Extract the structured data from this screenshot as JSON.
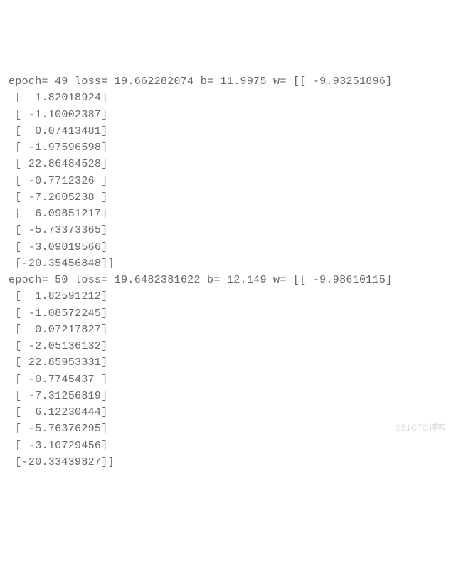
{
  "blocks": [
    {
      "epoch": 49,
      "loss": "19.662282074",
      "b": "11.9975",
      "w": [
        " -9.93251896",
        "  1.82018924",
        " -1.10002387",
        "  0.07413481",
        " -1.97596598",
        " 22.86484528",
        " -0.7712326 ",
        " -7.2605238 ",
        "  6.09851217",
        " -5.73373365",
        " -3.09019566",
        "-20.35456848"
      ]
    },
    {
      "epoch": 50,
      "loss": "19.6482381622",
      "b": "12.149",
      "w": [
        " -9.98610115",
        "  1.82591212",
        " -1.08572245",
        "  0.07217827",
        " -2.05136132",
        " 22.85953331",
        " -0.7745437 ",
        " -7.31256819",
        "  6.12230444",
        " -5.76376295",
        " -3.10729456",
        "-20.33439827"
      ]
    }
  ],
  "watermark": "©51CTO博客"
}
